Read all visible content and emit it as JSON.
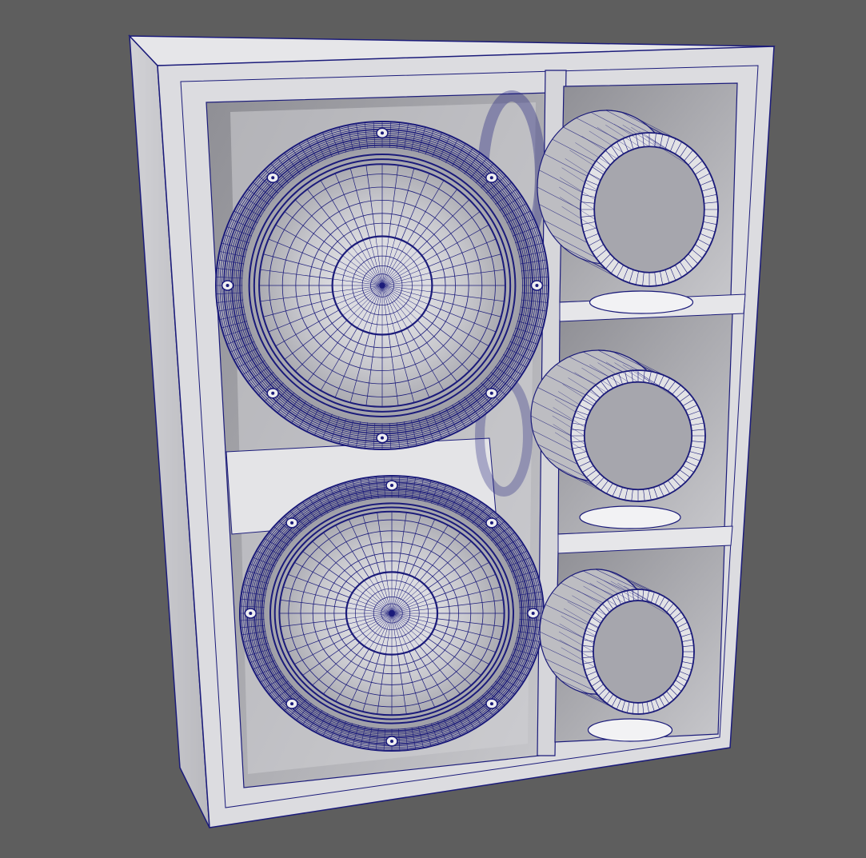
{
  "viewport": {
    "background": "#5e5e5e",
    "wire_color": "#1b1b7a",
    "surface_light": "#d9d9dc",
    "surface_mid": "#b8b8bc",
    "surface_dark": "#8e8e94"
  },
  "scene": {
    "objects": [
      {
        "name": "cabinet-shell",
        "kind": "box"
      },
      {
        "name": "woofer-top",
        "kind": "speaker-cone"
      },
      {
        "name": "woofer-bottom",
        "kind": "speaker-cone"
      },
      {
        "name": "port-tube-top",
        "kind": "port-tube"
      },
      {
        "name": "port-tube-middle",
        "kind": "port-tube"
      },
      {
        "name": "port-tube-bottom",
        "kind": "port-tube"
      }
    ]
  }
}
